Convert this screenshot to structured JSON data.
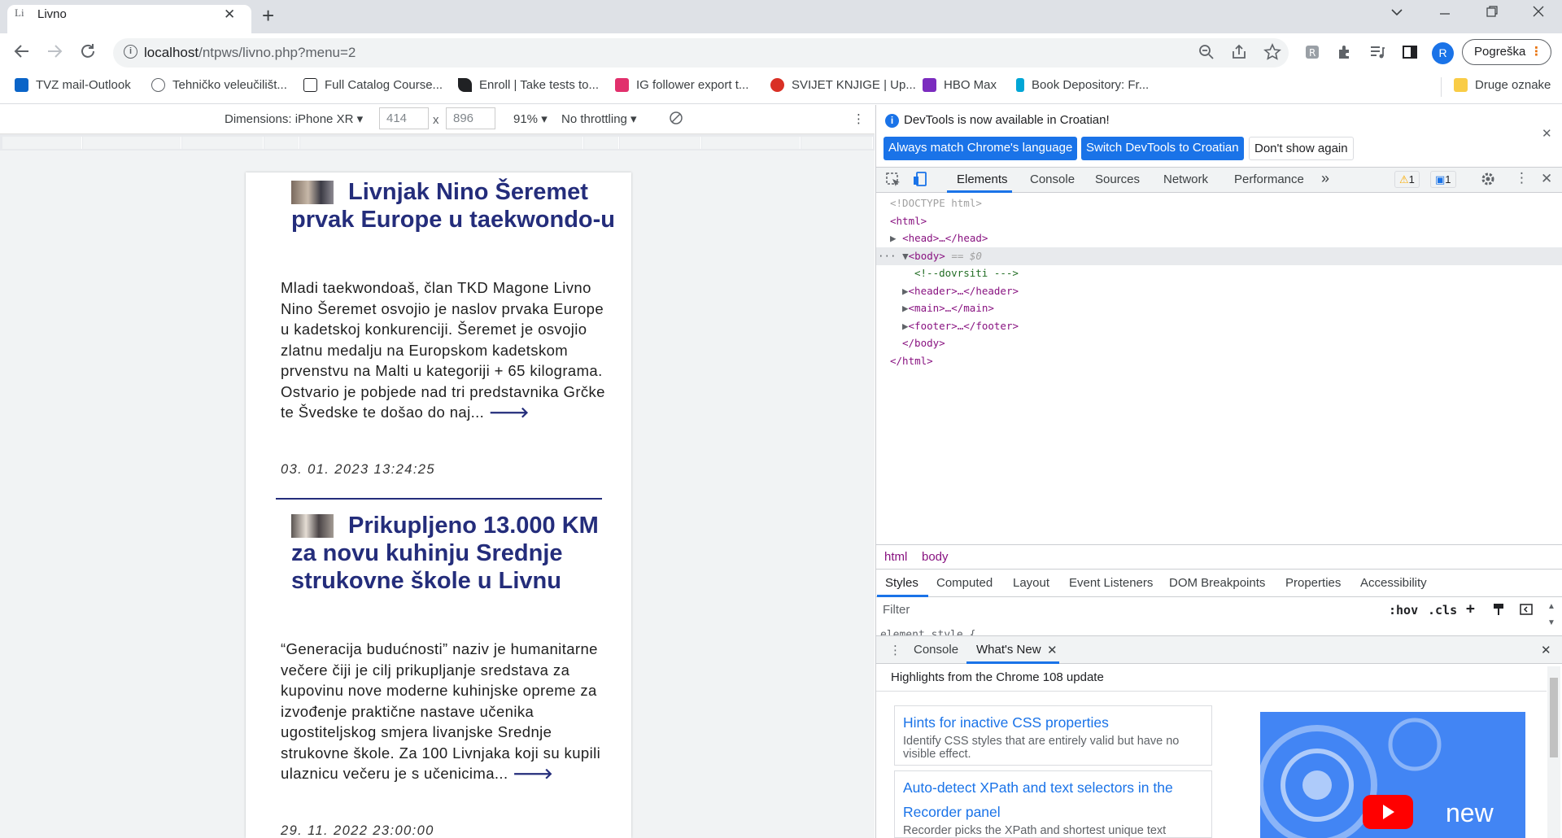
{
  "browser": {
    "tab": {
      "favicon_text": "Li",
      "title": "Livno"
    },
    "url": {
      "host": "localhost",
      "path": "/ntpws/livno.php?menu=2"
    },
    "profile_initial": "R",
    "error_button": "Pogreška",
    "bookmarks": [
      {
        "label": "TVZ mail-Outlook",
        "color": "#0a64c8"
      },
      {
        "label": "Tehničko veleučilišt...",
        "color": "#5f6368"
      },
      {
        "label": "Full Catalog Course...",
        "color": "#202124"
      },
      {
        "label": "Enroll | Take tests to...",
        "color": "#202124"
      },
      {
        "label": "IG follower export t...",
        "color": "#e1306c"
      },
      {
        "label": "SVIJET KNJIGE | Up...",
        "color": "#d93025"
      },
      {
        "label": "HBO Max",
        "color": "#7b2cbf"
      },
      {
        "label": "Book Depository: Fr...",
        "color": "#00a6d6"
      },
      {
        "label": "Druge oznake",
        "color": "#f9cc46"
      }
    ]
  },
  "device_toolbar": {
    "dimensions_label": "Dimensions: iPhone XR",
    "width": "414",
    "times": "x",
    "height": "896",
    "zoom": "91%",
    "throttling": "No throttling"
  },
  "articles": [
    {
      "title": "Livnjak Nino Šeremet prvak Europe u taekwondo-u",
      "text": "Mladi taekwondoaš, član TKD Magone Livno Nino Šeremet osvojio je naslov prvaka Europe u kadetskoj konkurenciji. Šeremet je osvojio zlatnu medalju na Europskom kadetskom prvenstvu na Malti u kategoriji + 65 kilograma. Ostvario je pobjede nad tri predstavnika Grčke te Švedske te došao do naj...",
      "date": "03. 01. 2023 13:24:25"
    },
    {
      "title": "Prikupljeno 13.000 KM za novu kuhinju Srednje strukovne škole u Livnu",
      "text": "“Generacija budućnosti” naziv je humanitarne večere čiji je cilj prikupljanje sredstava za kupovinu nove moderne kuhinjske opreme za izvođenje praktične nastave učenika ugostiteljskog smjera livanjske Srednje strukovne škole. Za 100 Livnjaka koji su kupili ulaznicu večeru je s učenicima...",
      "date": "29. 11. 2022 23:00:00"
    }
  ],
  "devtools": {
    "banner": {
      "text": "DevTools is now available in Croatian!",
      "btn_match": "Always match Chrome's language",
      "btn_switch": "Switch DevTools to Croatian",
      "btn_dismiss": "Don't show again"
    },
    "tabs": [
      "Elements",
      "Console",
      "Sources",
      "Network",
      "Performance"
    ],
    "warnings": "1",
    "messages": "1",
    "dom": {
      "doctype": "<!DOCTYPE html>",
      "html_open": "<html>",
      "head": "<head>…</head>",
      "body_open": "<body>",
      "body_marker": " == $0",
      "comment": "<!--dovrsiti --->",
      "header": "<header>…</header>",
      "main": "<main>…</main>",
      "footer": "<footer>…</footer>",
      "body_close": "</body>",
      "html_close": "</html>"
    },
    "breadcrumbs": [
      "html",
      "body"
    ],
    "styles_tabs": [
      "Styles",
      "Computed",
      "Layout",
      "Event Listeners",
      "DOM Breakpoints",
      "Properties",
      "Accessibility"
    ],
    "filter_placeholder": "Filter",
    "hov": ":hov",
    "cls": ".cls",
    "element_style": "element.style {",
    "drawer_tabs": [
      "Console",
      "What's New"
    ],
    "highlights": "Highlights from the Chrome 108 update",
    "cards": [
      {
        "title": "Hints for inactive CSS properties",
        "desc": "Identify CSS styles that are entirely valid but have no visible effect."
      },
      {
        "title": "Auto-detect XPath and text selectors in the Recorder panel",
        "desc": "Recorder picks the XPath and shortest unique text"
      }
    ],
    "promo_text": "new"
  }
}
